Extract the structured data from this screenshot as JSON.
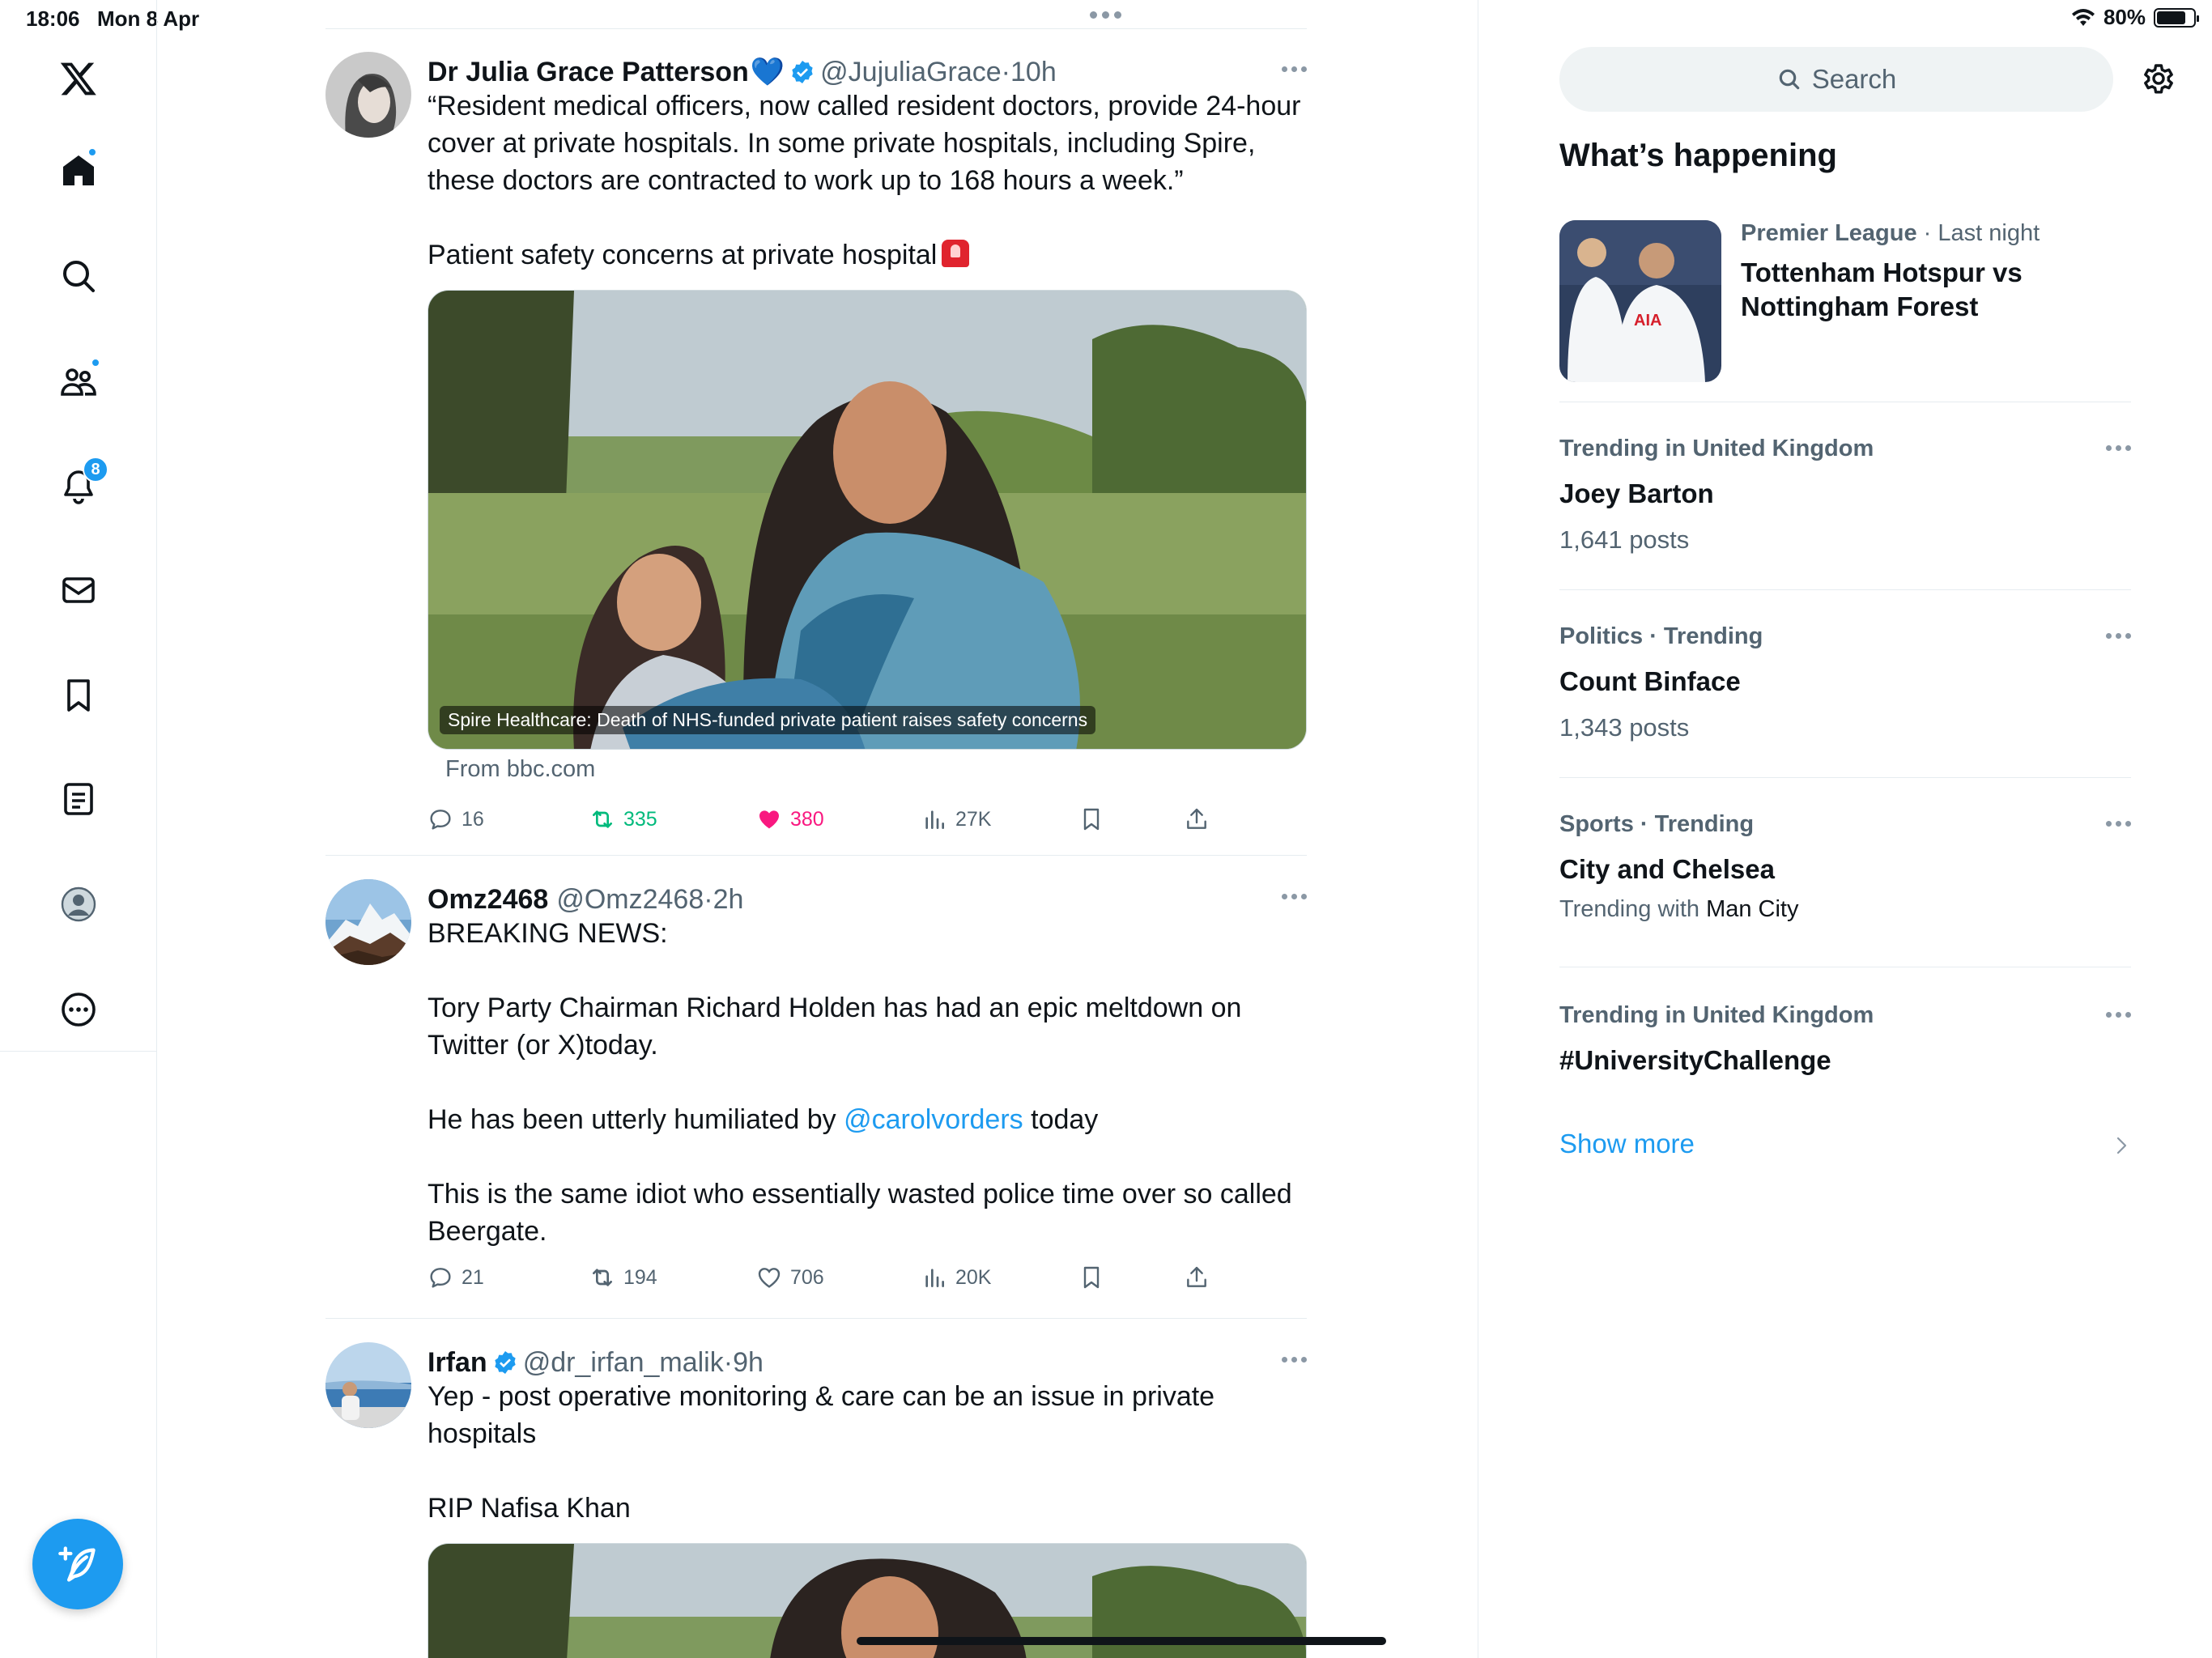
{
  "status_bar": {
    "time": "18:06",
    "date": "Mon 8 Apr",
    "battery": "80%"
  },
  "sidebar": {
    "items": [
      {
        "name": "x-logo-icon"
      },
      {
        "name": "home-icon",
        "active": true
      },
      {
        "name": "search-icon"
      },
      {
        "name": "communities-icon"
      },
      {
        "name": "notifications-icon",
        "badge": "8"
      },
      {
        "name": "messages-icon"
      },
      {
        "name": "bookmarks-icon"
      },
      {
        "name": "lists-icon"
      },
      {
        "name": "profile-icon"
      },
      {
        "name": "more-icon"
      }
    ],
    "compose_icon": "compose-post-icon"
  },
  "tweets": [
    {
      "name": "Dr Julia Grace Patterson",
      "heart": "💙",
      "handle": "@JujuliaGrace",
      "sep": "·",
      "time": "10h",
      "verified": true,
      "text": "“Resident medical officers, now called resident doctors, provide 24-hour cover at private hospitals. In some private hospitals, including Spire, these doctors are contracted to work up to 168 hours a week.”\n\nPatient safety concerns at private hospital",
      "media_caption": "Spire Healthcare: Death of NHS-funded private patient raises safety concerns",
      "media_source": "From bbc.com",
      "replies": "16",
      "reposts": "335",
      "likes": "380",
      "views": "27K"
    },
    {
      "name": "Omz2468",
      "handle": "@Omz2468",
      "sep": "·",
      "time": "2h",
      "text_1": "BREAKING NEWS:\n\nTory Party Chairman Richard Holden has had an epic meltdown on Twitter (or X)today.\n\nHe has been utterly humiliated by ",
      "mention": "@carolvorders",
      "text_2": " today\n\nThis is the same idiot who essentially wasted police time over so called Beergate.",
      "replies": "21",
      "reposts": "194",
      "likes": "706",
      "views": "20K"
    },
    {
      "name": "Irfan",
      "handle": "@dr_irfan_malik",
      "sep": "·",
      "time": "9h",
      "verified": true,
      "text": "Yep - post operative monitoring & care can be an issue in private hospitals\n\nRIP Nafisa Khan"
    }
  ],
  "right": {
    "search_placeholder": "Search",
    "section_title": "What’s happening",
    "featured": {
      "category": "Premier League",
      "sep": " · ",
      "when": "Last night",
      "title": "Tottenham Hotspur vs Nottingham Forest"
    },
    "trends": [
      {
        "meta": "Trending in United Kingdom",
        "name": "Joey Barton",
        "count": "1,641 posts"
      },
      {
        "meta": "Politics · Trending",
        "name": "Count Binface",
        "count": "1,343 posts"
      },
      {
        "meta": "Sports · Trending",
        "name": "City and Chelsea",
        "with_prefix": "Trending with ",
        "with_value": "Man City"
      },
      {
        "meta": "Trending in United Kingdom",
        "name": "#UniversityChallenge"
      }
    ],
    "show_more": "Show more"
  },
  "colors": {
    "accent": "#1d9bf0",
    "repost": "#00ba7c",
    "like": "#f91880",
    "muted": "#536471"
  }
}
